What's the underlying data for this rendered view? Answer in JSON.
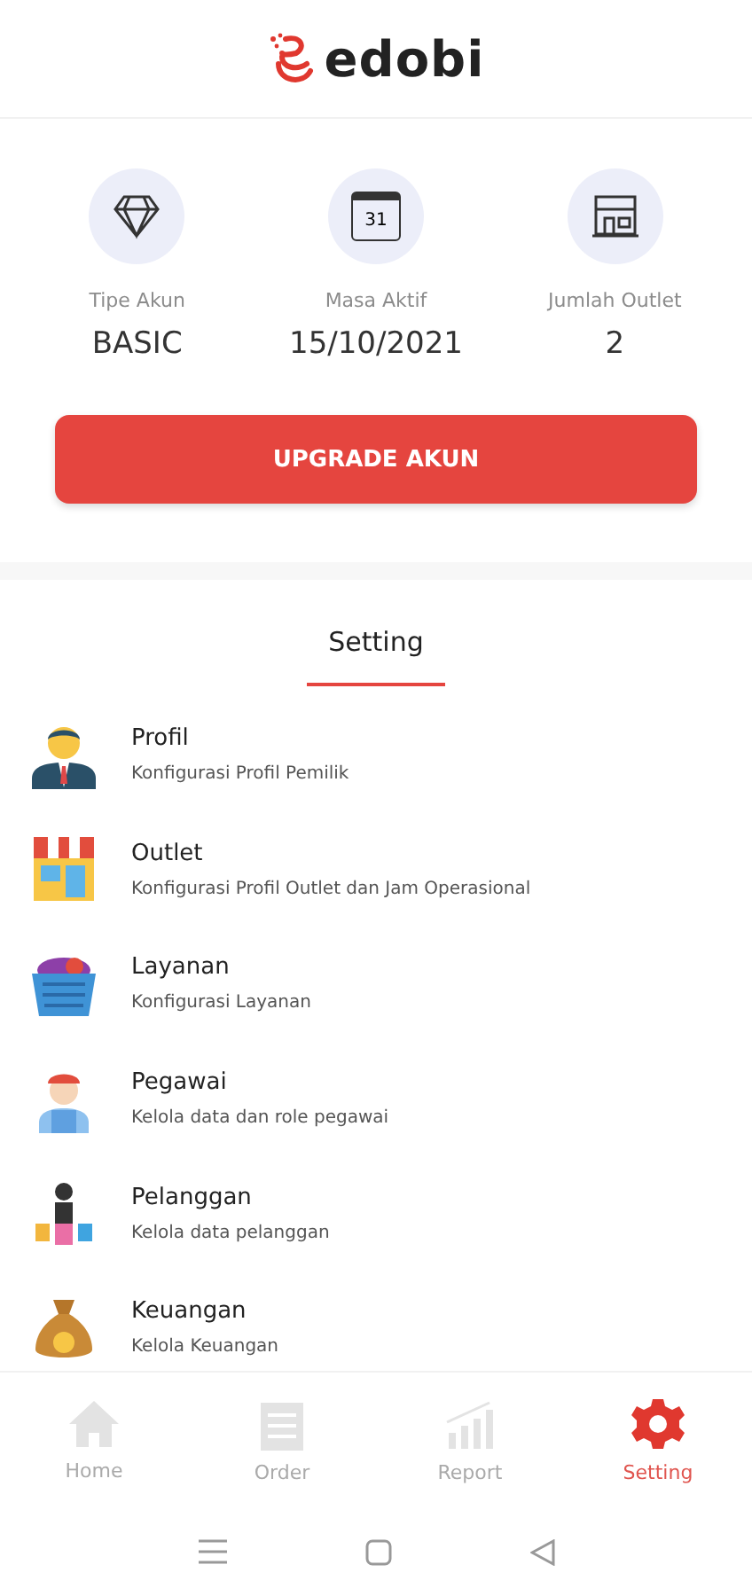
{
  "brand": "edobi",
  "stats": [
    {
      "kind": "diamond",
      "label": "Tipe Akun",
      "value": "BASIC"
    },
    {
      "kind": "calendar",
      "label": "Masa Aktif",
      "value": "15/10/2021",
      "icon_text": "31"
    },
    {
      "kind": "store",
      "label": "Jumlah Outlet",
      "value": "2"
    }
  ],
  "upgrade_button": "UPGRADE AKUN",
  "tabs": [
    {
      "label": "Setting",
      "selected": true
    }
  ],
  "settings": [
    {
      "kind": "person",
      "title": "Profil",
      "subtitle": "Konfigurasi Profil Pemilik"
    },
    {
      "kind": "shop",
      "title": "Outlet",
      "subtitle": "Konfigurasi Profil Outlet dan Jam Operasional"
    },
    {
      "kind": "basket",
      "title": "Layanan",
      "subtitle": "Konfigurasi Layanan"
    },
    {
      "kind": "worker",
      "title": "Pegawai",
      "subtitle": "Kelola data dan role pegawai"
    },
    {
      "kind": "shopper",
      "title": "Pelanggan",
      "subtitle": "Kelola data pelanggan"
    },
    {
      "kind": "money",
      "title": "Keuangan",
      "subtitle": "Kelola Keuangan"
    }
  ],
  "nav": [
    {
      "kind": "home",
      "label": "Home",
      "selected": false
    },
    {
      "kind": "order",
      "label": "Order",
      "selected": false
    },
    {
      "kind": "report",
      "label": "Report",
      "selected": false
    },
    {
      "kind": "gear",
      "label": "Setting",
      "selected": true
    }
  ]
}
